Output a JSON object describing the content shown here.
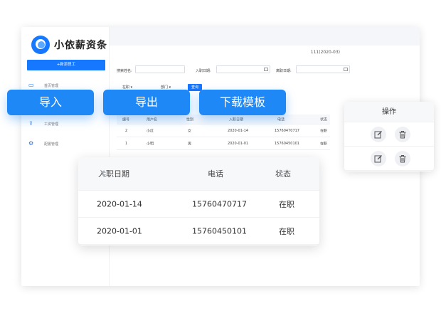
{
  "app": {
    "logo_text": "小依薪资条",
    "add_button": "+新添员工",
    "nav": [
      {
        "label": "首页管理",
        "icon": "monitor-icon"
      },
      {
        "label": "工资管理",
        "icon": "upload-icon"
      },
      {
        "label": "配置管理",
        "icon": "gear-icon"
      }
    ],
    "breadcrumb": "111(2020-03)",
    "filters": {
      "name_label": "搜索姓名:",
      "hire_date_label": "入职日期:",
      "leave_date_label": "离职日期:"
    },
    "selects": {
      "status": "在职",
      "department": "部门"
    },
    "query_button": "查询",
    "mini_table": {
      "headers": [
        "编号",
        "用户名",
        "性别",
        "入职日期",
        "电话",
        "状态"
      ],
      "rows": [
        [
          "2",
          "小红",
          "女",
          "2020-01-14",
          "15760470717",
          "在职"
        ],
        [
          "1",
          "小明",
          "男",
          "2020-01-01",
          "15760450101",
          "在职"
        ]
      ]
    }
  },
  "actions": {
    "import": "导入",
    "export": "导出",
    "download_template": "下载模板"
  },
  "action_card": {
    "title": "操作",
    "rows": [
      {
        "edit": "edit-icon",
        "delete": "trash-icon"
      },
      {
        "edit": "edit-icon",
        "delete": "trash-icon"
      }
    ]
  },
  "zoom_table": {
    "headers": [
      "入职日期",
      "电话",
      "状态"
    ],
    "rows": [
      [
        "2020-01-14",
        "15760470717",
        "在职"
      ],
      [
        "2020-01-01",
        "15760450101",
        "在职"
      ]
    ]
  },
  "colors": {
    "accent": "#1677ff",
    "pill": "#1e88f7"
  }
}
